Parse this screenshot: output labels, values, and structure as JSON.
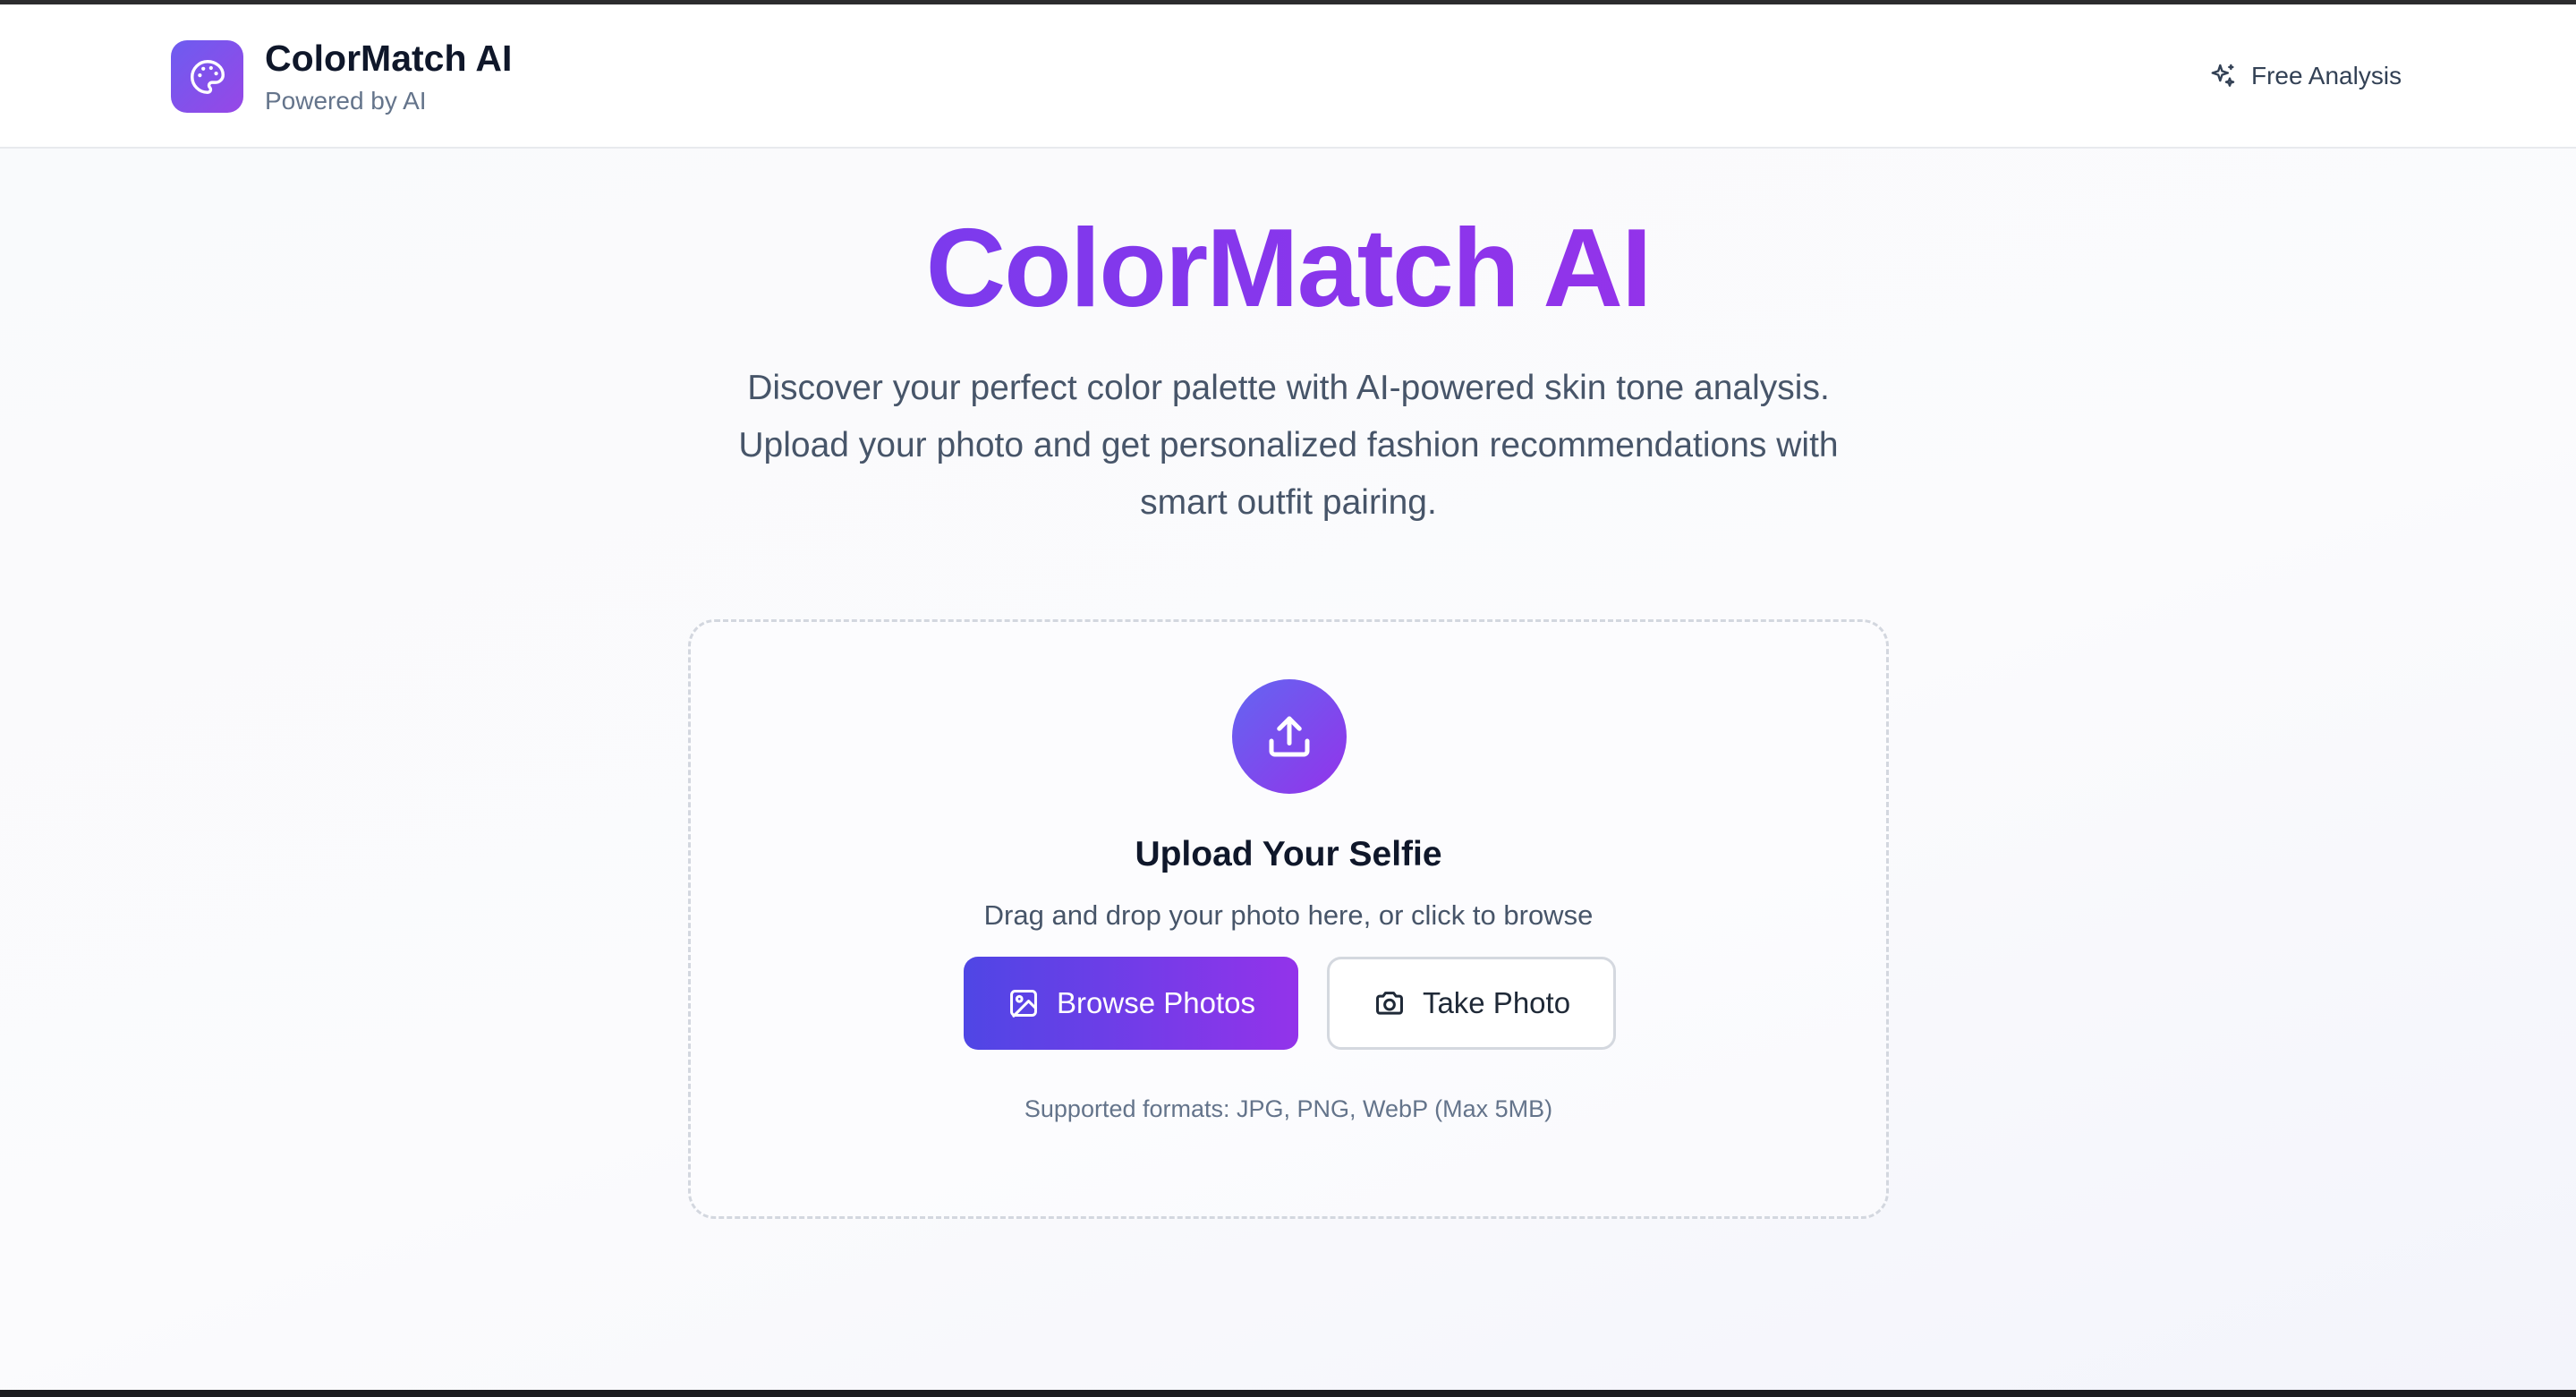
{
  "header": {
    "brand_name": "ColorMatch AI",
    "brand_subtitle": "Powered by AI",
    "logo_icon": "palette-icon",
    "nav_action": {
      "label": "Free Analysis",
      "icon": "sparkles-icon"
    }
  },
  "hero": {
    "title": "ColorMatch AI",
    "description": "Discover your perfect color palette with AI-powered skin tone analysis. Upload your photo and get personalized fashion recommendations with smart outfit pairing."
  },
  "upload": {
    "icon": "upload-icon",
    "title": "Upload Your Selfie",
    "hint": "Drag and drop your photo here, or click to browse",
    "browse_button": {
      "label": "Browse Photos",
      "icon": "image-icon"
    },
    "camera_button": {
      "label": "Take Photo",
      "icon": "camera-icon"
    },
    "supported_formats": "Supported formats: JPG, PNG, WebP (Max 5MB)"
  },
  "colors": {
    "brand_gradient_start": "#6366f1",
    "brand_gradient_end": "#9333ea",
    "title_purple": "#7c3aed",
    "text_dark": "#0f172a",
    "text_muted": "#475569",
    "card_border": "#d3d7df"
  }
}
